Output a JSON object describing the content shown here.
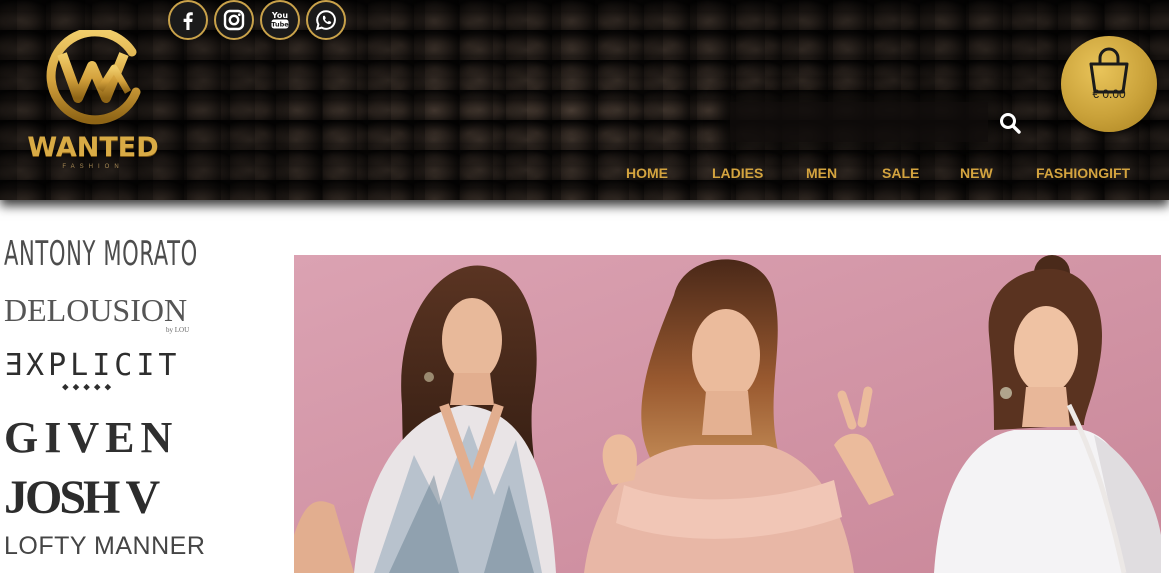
{
  "header": {
    "social": [
      {
        "icon": "facebook-icon",
        "label": "Facebook"
      },
      {
        "icon": "instagram-icon",
        "label": "Instagram"
      },
      {
        "icon": "youtube-icon",
        "label": "YouTube",
        "text": "You Tube"
      },
      {
        "icon": "whatsapp-icon",
        "label": "WhatsApp"
      }
    ],
    "logo": {
      "wordmark": "WANTED",
      "tagline": "FASHION",
      "color": "#d9ab45"
    },
    "search": {
      "placeholder": "",
      "value": ""
    },
    "cart": {
      "total": "€ 0.00",
      "color": "#caa23a"
    },
    "nav": [
      "HOME",
      "LADIES",
      "MEN",
      "SALE",
      "NEW",
      "FASHIONGIFT"
    ],
    "nav_color": "#d4a43f"
  },
  "brands": {
    "antony": "ANTONY MORATO",
    "delousion": "DELOUSION",
    "delousion_by": "by LOU",
    "explicit": "ƎXPLICIT",
    "explicit_mark": "◆◆◆◆◆",
    "given": "GIVEN",
    "josh": "JOSH V",
    "lofty": "LOFTY MANNER"
  },
  "hero": {
    "background": "#d79aaa"
  }
}
